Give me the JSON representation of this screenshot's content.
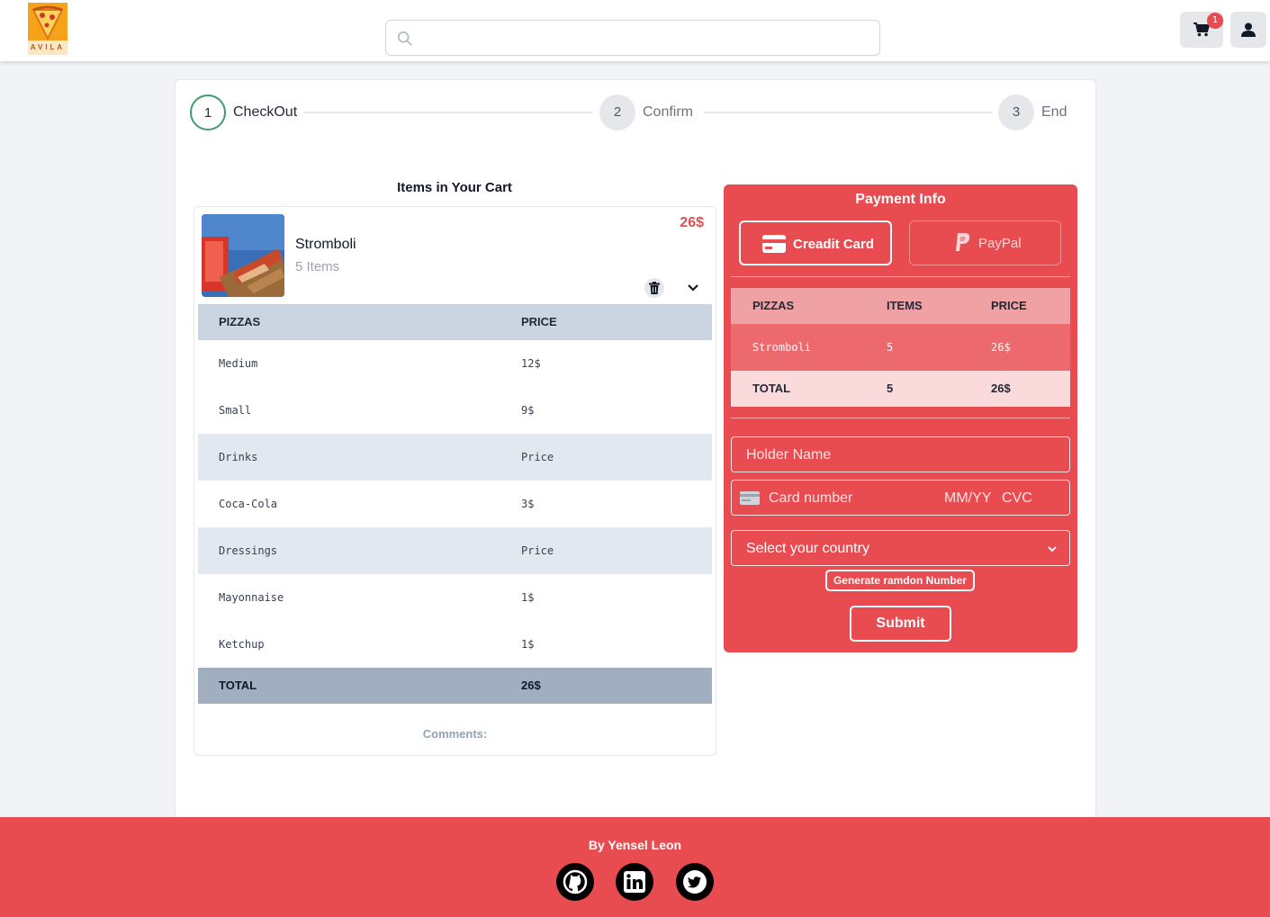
{
  "header": {
    "logo_text": "AVILA",
    "search_placeholder": "",
    "cart_badge": "1"
  },
  "stepper": {
    "steps": [
      {
        "number": "1",
        "label": "CheckOut",
        "state": "active"
      },
      {
        "number": "2",
        "label": "Confirm",
        "state": "idle"
      },
      {
        "number": "3",
        "label": "End",
        "state": "idle"
      }
    ]
  },
  "cart": {
    "title": "Items in Your Cart",
    "item": {
      "name": "Stromboli",
      "count": "5 Items",
      "price": "26$"
    },
    "table": {
      "header": [
        "PIZZAS",
        "PRICE"
      ],
      "rows": [
        {
          "type": "item",
          "name": "Medium",
          "price": "12$"
        },
        {
          "type": "item",
          "name": "Small",
          "price": "9$"
        },
        {
          "type": "sub",
          "name": "Drinks",
          "price": "Price"
        },
        {
          "type": "item",
          "name": "Coca-Cola",
          "price": "3$"
        },
        {
          "type": "sub",
          "name": "Dressings",
          "price": "Price"
        },
        {
          "type": "item",
          "name": "Mayonnaise",
          "price": "1$"
        },
        {
          "type": "item",
          "name": "Ketchup",
          "price": "1$"
        }
      ],
      "total": {
        "label": "TOTAL",
        "price": "26$"
      }
    },
    "comments_label": "Comments:"
  },
  "payment": {
    "title": "Payment Info",
    "methods": {
      "credit_card": "Creadit Card",
      "paypal": "PayPal"
    },
    "summary": {
      "header": [
        "PIZZAS",
        "ITEMS",
        "PRICE"
      ],
      "rows": [
        {
          "name": "Stromboli",
          "items": "5",
          "price": "26$"
        }
      ],
      "total": {
        "label": "TOTAL",
        "items": "5",
        "price": "26$"
      }
    },
    "holder_placeholder": "Holder Name",
    "card_placeholder": "Card number",
    "expiry_placeholder": "MM/YY",
    "cvc_placeholder": "CVC",
    "country_placeholder": "Select your country",
    "generate_label": "Generate ramdon Number",
    "submit_label": "Submit"
  },
  "footer": {
    "by": "By Yensel Leon",
    "social": [
      "github-icon",
      "linkedin-icon",
      "twitter-icon"
    ]
  },
  "colors": {
    "brand_red": "#e84c51",
    "step_active": "#3f9c6c",
    "page_bg": "#f1f3f6"
  }
}
